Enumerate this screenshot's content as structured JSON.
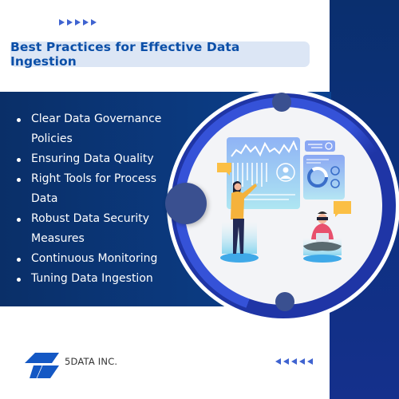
{
  "header": {
    "title": "Best Practices for Effective Data Ingestion",
    "decor_arrows_count": 5
  },
  "practices": [
    {
      "label": "Clear Data Governance Policies"
    },
    {
      "label": "Ensuring Data Quality"
    },
    {
      "label": "Right Tools for Process Data"
    },
    {
      "label": "Robust Data Security Measures"
    },
    {
      "label": "Continuous Monitoring"
    },
    {
      "label": "Tuning Data Ingestion"
    }
  ],
  "illustration": {
    "description": "Two people working with data dashboards: standing woman pointing at charts, seated man with VR headset and laptop",
    "icons": [
      "line-chart-icon",
      "bar-chart-icon",
      "user-profile-icon",
      "donut-chart-icon",
      "chat-bubble-icon"
    ]
  },
  "footer": {
    "brand": "5DATA INC.",
    "logo_icon": "5data-logo-icon"
  },
  "colors": {
    "navy": "#0a2f6e",
    "band_blue": "#0b3a80",
    "title_text": "#0b4fa8",
    "title_bg": "#dce6f5",
    "accent_arrow": "#3f63d0",
    "ring_blue": "#3552d8",
    "ring_navy": "#1f35a6",
    "dot": "#3a5090"
  }
}
